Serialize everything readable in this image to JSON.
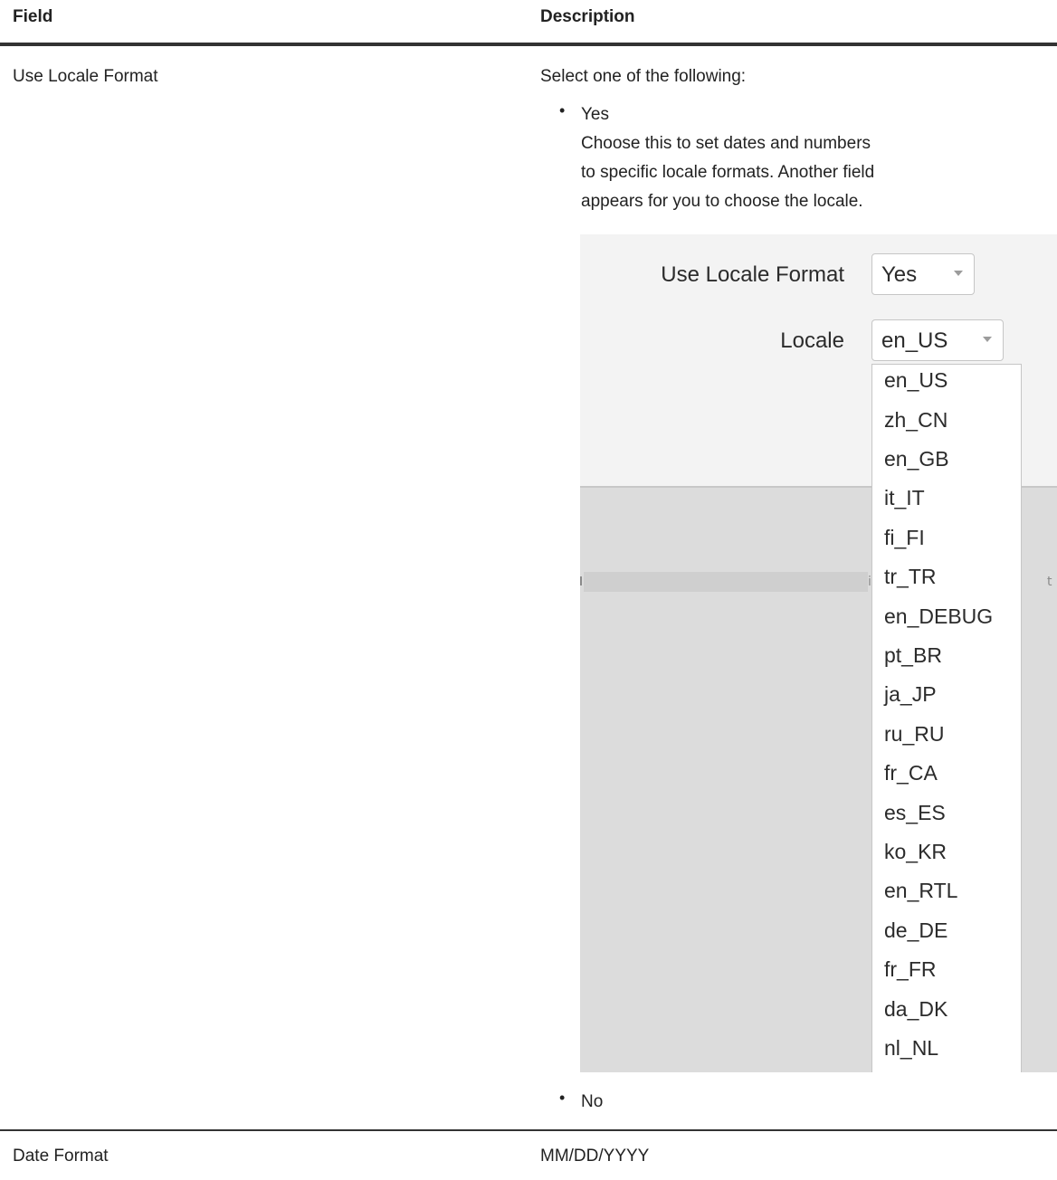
{
  "table": {
    "headers": {
      "field": "Field",
      "description": "Description"
    },
    "rows": [
      {
        "field": "Use Locale Format",
        "intro": "Select one of the following:",
        "option_yes": {
          "label": "Yes",
          "lines": [
            "Choose this to set dates and numbers",
            "to specific locale formats. Another field",
            "appears for you to choose the locale."
          ]
        },
        "option_no": {
          "label": "No"
        }
      },
      {
        "field": "Date Format",
        "description": "MM/DD/YYYY"
      }
    ]
  },
  "screenshot": {
    "use_locale_label": "Use Locale Format",
    "use_locale_value": "Yes",
    "locale_label": "Locale",
    "locale_value": "en_US",
    "locale_options": [
      "en_US",
      "zh_CN",
      "en_GB",
      "it_IT",
      "fi_FI",
      "tr_TR",
      "en_DEBUG",
      "pt_BR",
      "ja_JP",
      "ru_RU",
      "fr_CA",
      "es_ES",
      "ko_KR",
      "en_RTL",
      "de_DE",
      "fr_FR",
      "da_DK",
      "nl_NL"
    ],
    "partial_glyph_mid": "i",
    "partial_glyph_right": "t"
  },
  "colors": {
    "rule": "#333333",
    "panel": "#f3f3f3",
    "overlay": "#dcdcdc"
  }
}
